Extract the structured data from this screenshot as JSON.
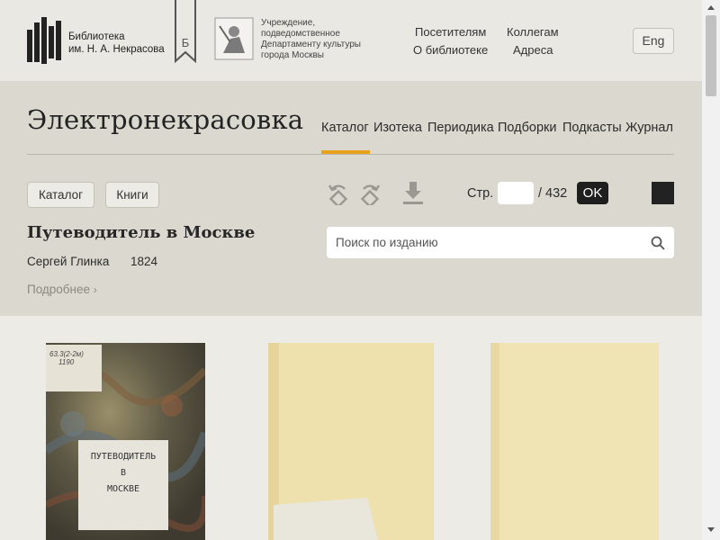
{
  "header": {
    "logo_line1": "Библиотека",
    "logo_line2": "им. Н. А. Некрасова",
    "bookmark_letter": "Б",
    "dept_line1": "Учреждение,",
    "dept_line2": "подведомственное",
    "dept_line3": "Департаменту культуры",
    "dept_line4": "города Москвы",
    "nav": [
      "Посетителям",
      "Коллегам",
      "О библиотеке",
      "Адреса"
    ],
    "lang": "Eng"
  },
  "main": {
    "site_title": "Электронекрасовка",
    "sections": [
      "Каталог",
      "Изотека",
      "Периодика",
      "Подборки",
      "Подкасты",
      "Журнал"
    ],
    "active_section": "Каталог",
    "accent_color": "#e8a21b",
    "crumbs": [
      "Каталог",
      "Книги"
    ],
    "book_title": "Путеводитель в Москве",
    "author": "Сергей Глинка",
    "year": "1824",
    "more_label": "Подробнее",
    "toolbar": {
      "icons": [
        "rotate-left-icon",
        "rotate-right-icon",
        "download-icon"
      ],
      "page_label": "Стр.",
      "page_value": "",
      "page_total": "/ 432",
      "ok_label": "OK"
    },
    "search": {
      "placeholder": "Поиск по изданию"
    }
  },
  "thumbnails": [
    {
      "cover_line1": "ПУТЕВОДИТЕЛЬ",
      "cover_line2": "В",
      "cover_line3": "МОСКВЕ",
      "tag_line1": "63.3(2-2м)",
      "tag_line2": "1190"
    },
    {
      "cover_line1": "",
      "cover_line2": "",
      "cover_line3": ""
    },
    {
      "cover_line1": "",
      "cover_line2": "",
      "cover_line3": ""
    }
  ]
}
